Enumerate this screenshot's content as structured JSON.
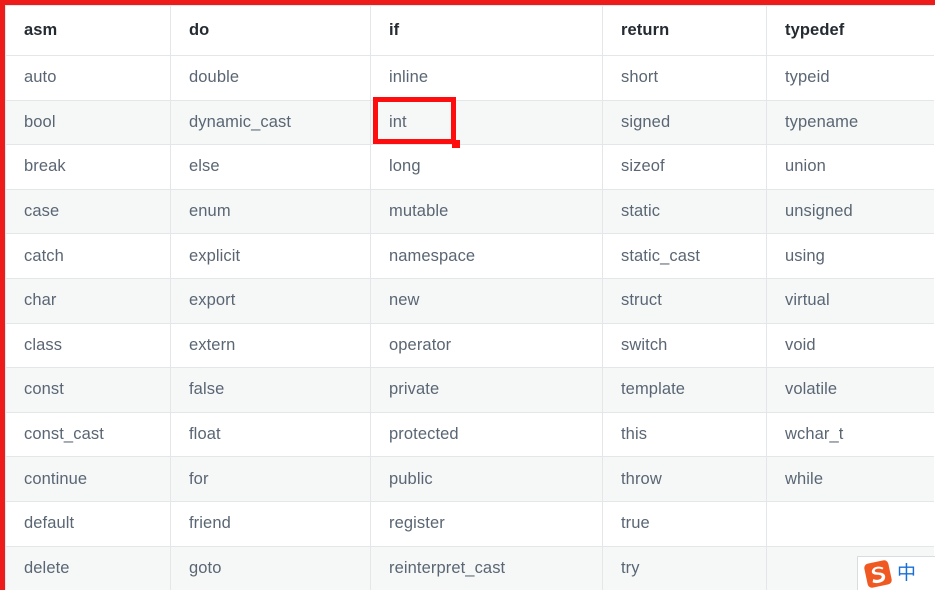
{
  "page": {
    "title": "C++ Keywords Reference Table",
    "accent_red": "#ee1b1b",
    "selection_red": "#fd0d0d",
    "row_shade": "#f6f8f8",
    "text_color": "#5a6673",
    "header_text_color": "#252b32",
    "border_color": "#e4e7ea"
  },
  "table": {
    "headers": [
      "asm",
      "do",
      "if",
      "return",
      "typedef"
    ],
    "rows": [
      [
        "auto",
        "double",
        "inline",
        "short",
        "typeid"
      ],
      [
        "bool",
        "dynamic_cast",
        "int",
        "signed",
        "typename"
      ],
      [
        "break",
        "else",
        "long",
        "sizeof",
        "union"
      ],
      [
        "case",
        "enum",
        "mutable",
        "static",
        "unsigned"
      ],
      [
        "catch",
        "explicit",
        "namespace",
        "static_cast",
        "using"
      ],
      [
        "char",
        "export",
        "new",
        "struct",
        "virtual"
      ],
      [
        "class",
        "extern",
        "operator",
        "switch",
        "void"
      ],
      [
        "const",
        "false",
        "private",
        "template",
        "volatile"
      ],
      [
        "const_cast",
        "float",
        "protected",
        "this",
        "wchar_t"
      ],
      [
        "continue",
        "for",
        "public",
        "throw",
        "while"
      ],
      [
        "default",
        "friend",
        "register",
        "true",
        ""
      ],
      [
        "delete",
        "goto",
        "reinterpret_cast",
        "try",
        ""
      ]
    ]
  },
  "selection": {
    "highlighted_cell_text": "int",
    "highlighted_cell_column": "if",
    "highlighted_cell_row_index": 2
  },
  "ime": {
    "logo_name": "sogou-logo",
    "mode_label": "中",
    "logo_color": "#f05a22",
    "mode_color": "#1a6fd4"
  }
}
